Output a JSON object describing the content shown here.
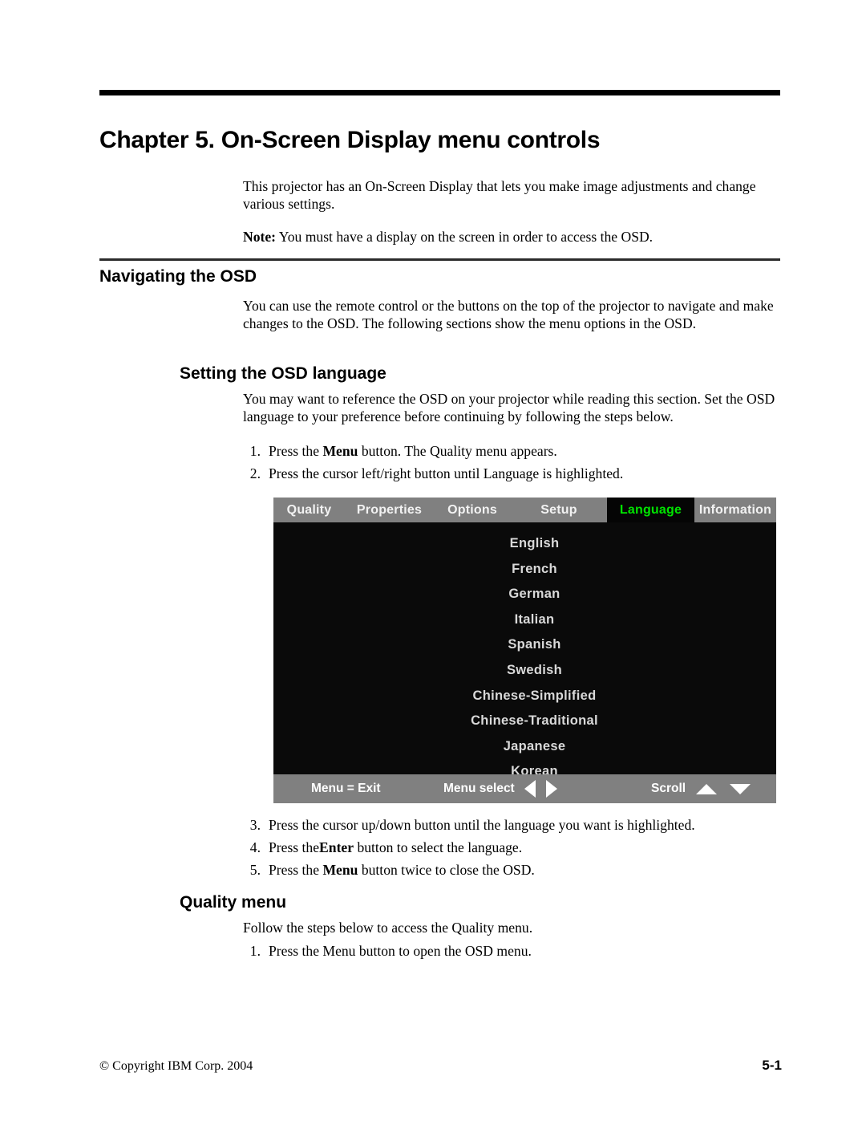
{
  "document": {
    "chapter_title": "Chapter 5. On-Screen Display menu controls",
    "intro_paragraph": "This projector has an On-Screen Display that lets you make image adjustments and change various settings.",
    "note_label": "Note:",
    "note_text": "You must have a display on the screen in order to access the OSD."
  },
  "sections": {
    "navigating": {
      "heading": "Navigating the OSD",
      "paragraph": "You can use the remote control or the buttons on the top of the projector to navigate and make changes to the OSD. The following sections show the menu options in the OSD."
    },
    "setting_language": {
      "heading": "Setting the OSD language",
      "paragraph": "You may want to reference the OSD on your projector while reading this section. Set the OSD language to your preference before continuing by following the steps below.",
      "steps_before": [
        {
          "num": "1.",
          "pre": "Press the ",
          "bold": "Menu",
          "post": " button. The Quality menu appears."
        },
        {
          "num": "2.",
          "pre": "Press the cursor left/right button until Language is highlighted.",
          "bold": "",
          "post": ""
        }
      ],
      "steps_after": [
        {
          "num": "3.",
          "pre": "Press the cursor up/down button until the language you want is highlighted.",
          "bold": "",
          "post": ""
        },
        {
          "num": "4.",
          "pre": "Press the",
          "bold": "Enter",
          "post": " button to select the language."
        },
        {
          "num": "5.",
          "pre": "Press the ",
          "bold": "Menu",
          "post": " button twice to close the OSD."
        }
      ]
    },
    "quality_menu": {
      "heading": "Quality menu",
      "paragraph": "Follow the steps below to access the Quality menu.",
      "steps": [
        {
          "num": "1.",
          "pre": "Press the Menu button to open the OSD menu.",
          "bold": "",
          "post": ""
        }
      ]
    }
  },
  "osd": {
    "tabs": [
      {
        "label": "Quality",
        "selected": false
      },
      {
        "label": "Properties",
        "selected": false
      },
      {
        "label": "Options",
        "selected": false
      },
      {
        "label": "Setup",
        "selected": false
      },
      {
        "label": "Language",
        "selected": true
      },
      {
        "label": "Information",
        "selected": false
      }
    ],
    "selected_tab": "Language",
    "languages": [
      "English",
      "French",
      "German",
      "Italian",
      "Spanish",
      "Swedish",
      "Chinese-Simplified",
      "Chinese-Traditional",
      "Japanese",
      "Korean"
    ],
    "statusbar": {
      "exit_hint": "Menu = Exit",
      "select_hint": "Menu select",
      "scroll_hint": "Scroll"
    },
    "colors": {
      "background": "#0a0a0a",
      "tab_bar": "#808080",
      "tab_text": "#f2f2f2",
      "selected_tab_bg": "#050505",
      "selected_tab_text": "#00e400",
      "language_text": "#d9d9d9",
      "statusbar_bg": "#808080",
      "statusbar_text": "#ffffff"
    }
  },
  "footer": {
    "copyright": "© Copyright IBM Corp. 2004",
    "page_number": "5-1"
  }
}
